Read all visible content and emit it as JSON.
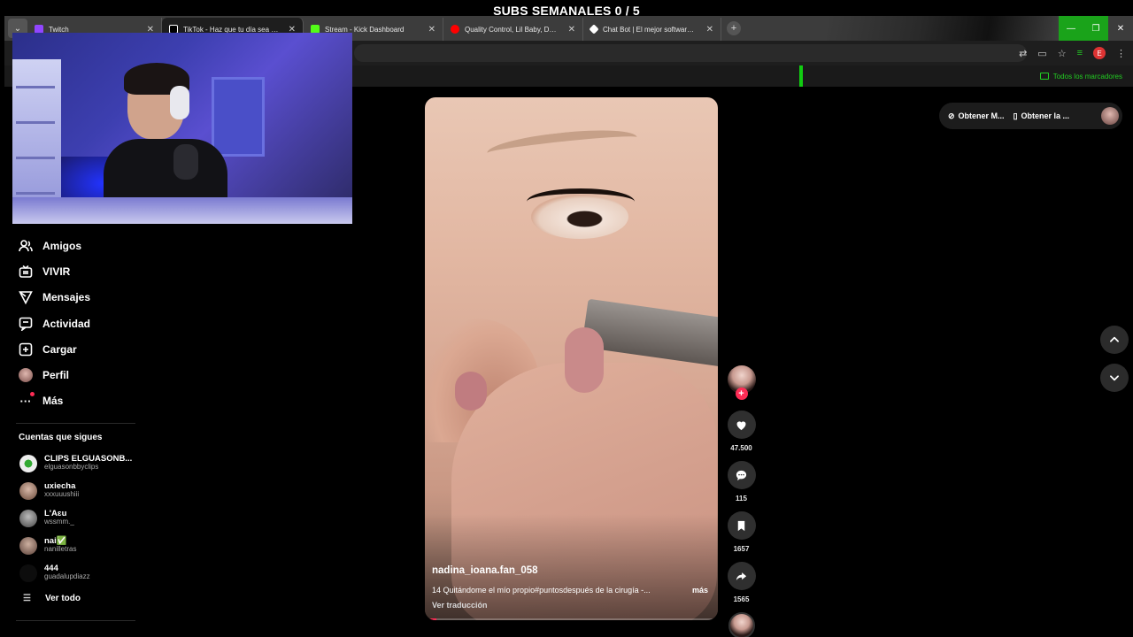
{
  "overlay": {
    "title": "SUBS SEMANALES 0 / 5"
  },
  "browser": {
    "tabs": [
      {
        "title": "Twitch",
        "favicon_color": "#9146ff"
      },
      {
        "title": "TikTok - Haz que tu día sea especial",
        "favicon_color": "#ffffff",
        "active": true
      },
      {
        "title": "Stream - Kick Dashboard",
        "favicon_color": "#53fc18"
      },
      {
        "title": "Quality Control, Lil Baby, DaBaby",
        "favicon_color": "#ff0000"
      },
      {
        "title": "Chat Bot | El mejor software para",
        "favicon_color": "#ffffff"
      }
    ],
    "bookmarks_all": "Todos los marcadores",
    "profile_initial": "E",
    "accent": "#1aa31a"
  },
  "sidebar": {
    "items": [
      {
        "label": "Amigos",
        "icon": "friends-icon"
      },
      {
        "label": "VIVIR",
        "icon": "live-icon"
      },
      {
        "label": "Mensajes",
        "icon": "messages-icon"
      },
      {
        "label": "Actividad",
        "icon": "activity-icon"
      },
      {
        "label": "Cargar",
        "icon": "upload-icon"
      },
      {
        "label": "Perfil",
        "icon": "profile-avatar"
      },
      {
        "label": "Más",
        "icon": "more-icon"
      }
    ],
    "following_title": "Cuentas que sigues",
    "following": [
      {
        "name": "CLIPS ELGUASONB...",
        "handle": "elguasonbbyclips",
        "color": "#e8e8e8"
      },
      {
        "name": "uxiecha",
        "handle": "xxxuuushiii",
        "color": "#b08a78"
      },
      {
        "name": "L'Aɛu",
        "handle": "wssmm._",
        "color": "#8a8a8a"
      },
      {
        "name": "nai✅",
        "handle": "nanilletras",
        "color": "#9a8070"
      },
      {
        "name": "444",
        "handle": "guadalupdiazz",
        "color": "#111111"
      }
    ],
    "see_all": "Ver todo"
  },
  "video": {
    "author": "nadina_ioana.fan_058",
    "description": "14 Quitándome el mío propio#puntosdespués de la cirugía -...",
    "more": "más",
    "translate": "Ver traducción",
    "progress": 0.04
  },
  "actions": {
    "likes": "47.500",
    "comments": "115",
    "saves": "1657",
    "shares": "1565"
  },
  "top_pill": {
    "item1": "Obtener M...",
    "item2": "Obtener la ..."
  }
}
